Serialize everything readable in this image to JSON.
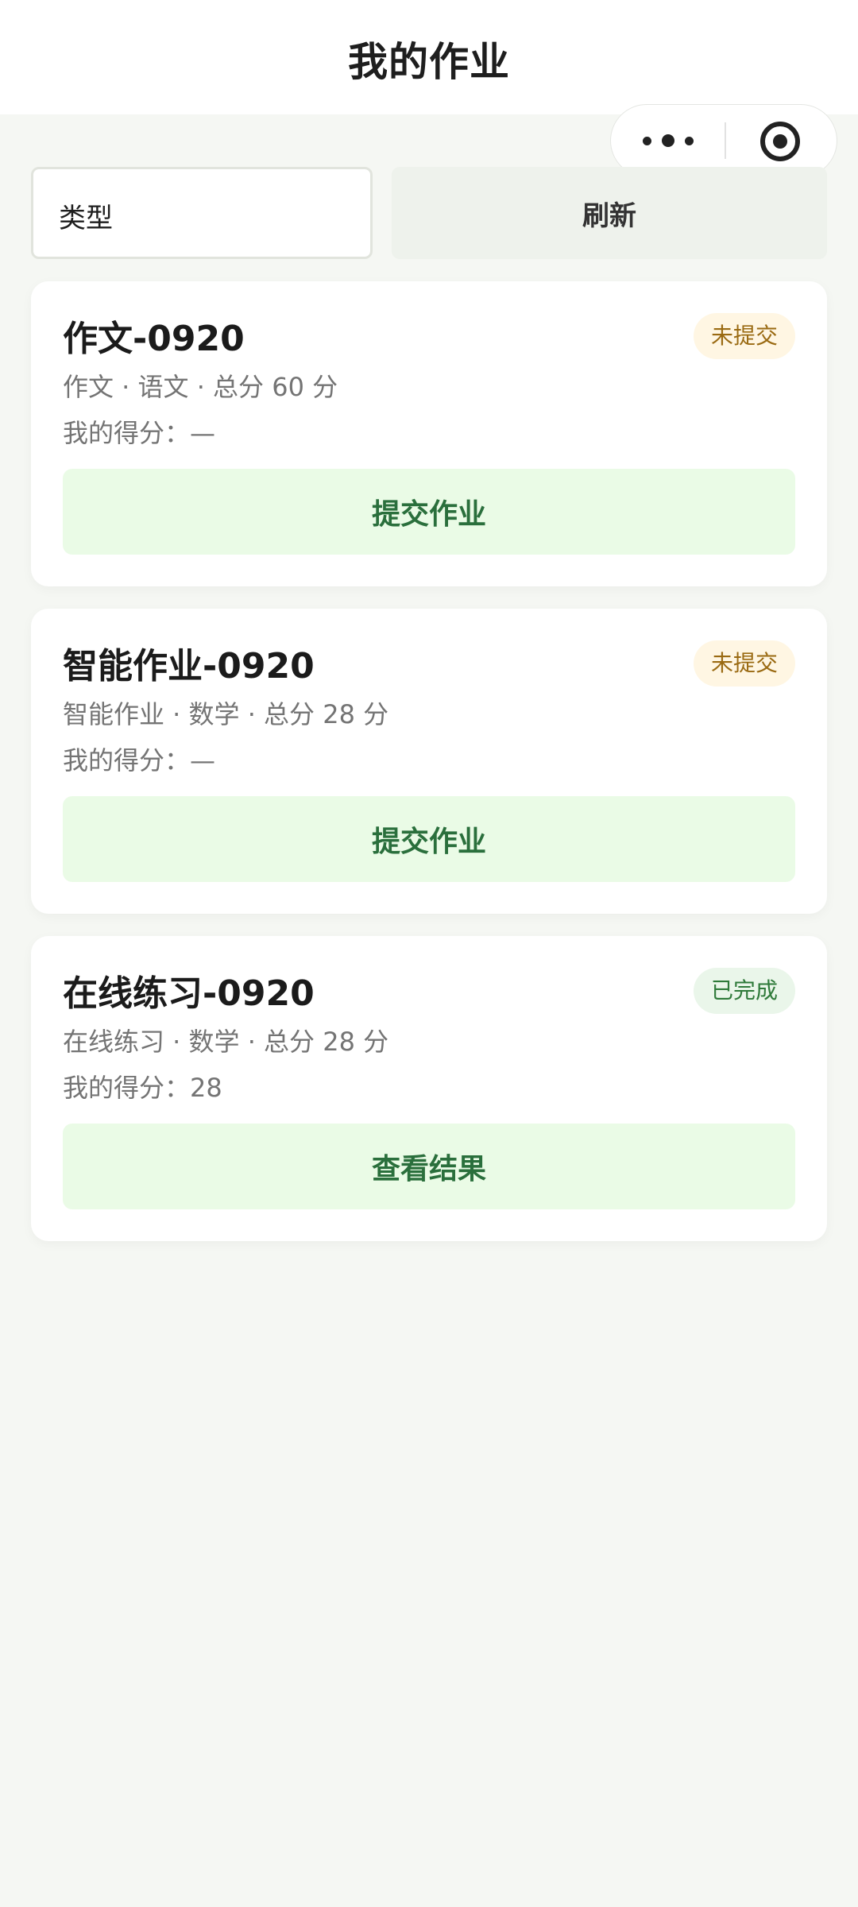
{
  "header": {
    "title": "我的作业"
  },
  "filter": {
    "type_label": "类型",
    "refresh_label": "刷新"
  },
  "assignments": [
    {
      "title": "作文-0920",
      "status": "未提交",
      "meta": "作文 · 语文 · 总分 60 分",
      "score": "我的得分：—",
      "action": "提交作业"
    },
    {
      "title": "智能作业-0920",
      "status": "未提交",
      "meta": "智能作业 · 数学 · 总分 28 分",
      "score": "我的得分：—",
      "action": "提交作业"
    },
    {
      "title": "在线练习-0920",
      "status": "已完成",
      "meta": "在线练习 · 数学 · 总分 28 分",
      "score": "我的得分：28",
      "action": "查看结果"
    }
  ],
  "icons": {
    "more": "more-dots-icon",
    "target": "target-icon"
  },
  "colors": {
    "background": "#f5f7f3",
    "action_bg": "#eafbe6",
    "action_text": "#2a6f3c",
    "pending_bg": "#fff6e3",
    "pending_text": "#9a6a12",
    "done_bg": "#eaf6ea",
    "done_text": "#2f7a3a"
  }
}
